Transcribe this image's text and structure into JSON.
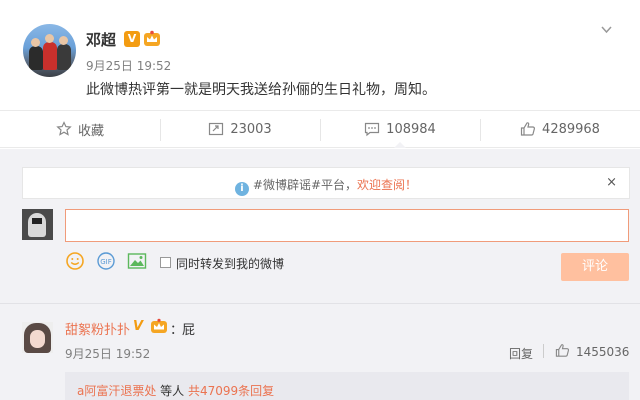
{
  "post": {
    "username": "邓超",
    "verified_badge": "V",
    "time": "9月25日 19:52",
    "text": "此微博热评第一就是明天我送给孙俪的生日礼物，周知。"
  },
  "actions": {
    "favorite_label": "收藏",
    "repost_count": "23003",
    "comment_count": "108984",
    "like_count": "4289968"
  },
  "comment_box": {
    "notice_prefix": "#微博辟谣#平台，",
    "notice_link": "欢迎查阅！",
    "close_glyph": "×",
    "input_value": "",
    "emoji_icon": "smile-icon",
    "gif_label": "GIF",
    "repost_also_label": "同时转发到我的微博",
    "submit_label": "评论"
  },
  "comments": [
    {
      "username": "甜絮粉扑扑",
      "vip_badge": "V",
      "colon": "：",
      "text": "屁",
      "time": "9月25日 19:52",
      "reply_label": "回复",
      "likes": "1455036",
      "subreply": {
        "user": "a阿富汗退票处",
        "mid": " 等人 ",
        "more": "共47099条回复"
      }
    }
  ],
  "colors": {
    "accent": "#eb7350",
    "submit_disabled": "#ffc09f",
    "comment_bg": "#f2f2f5"
  }
}
